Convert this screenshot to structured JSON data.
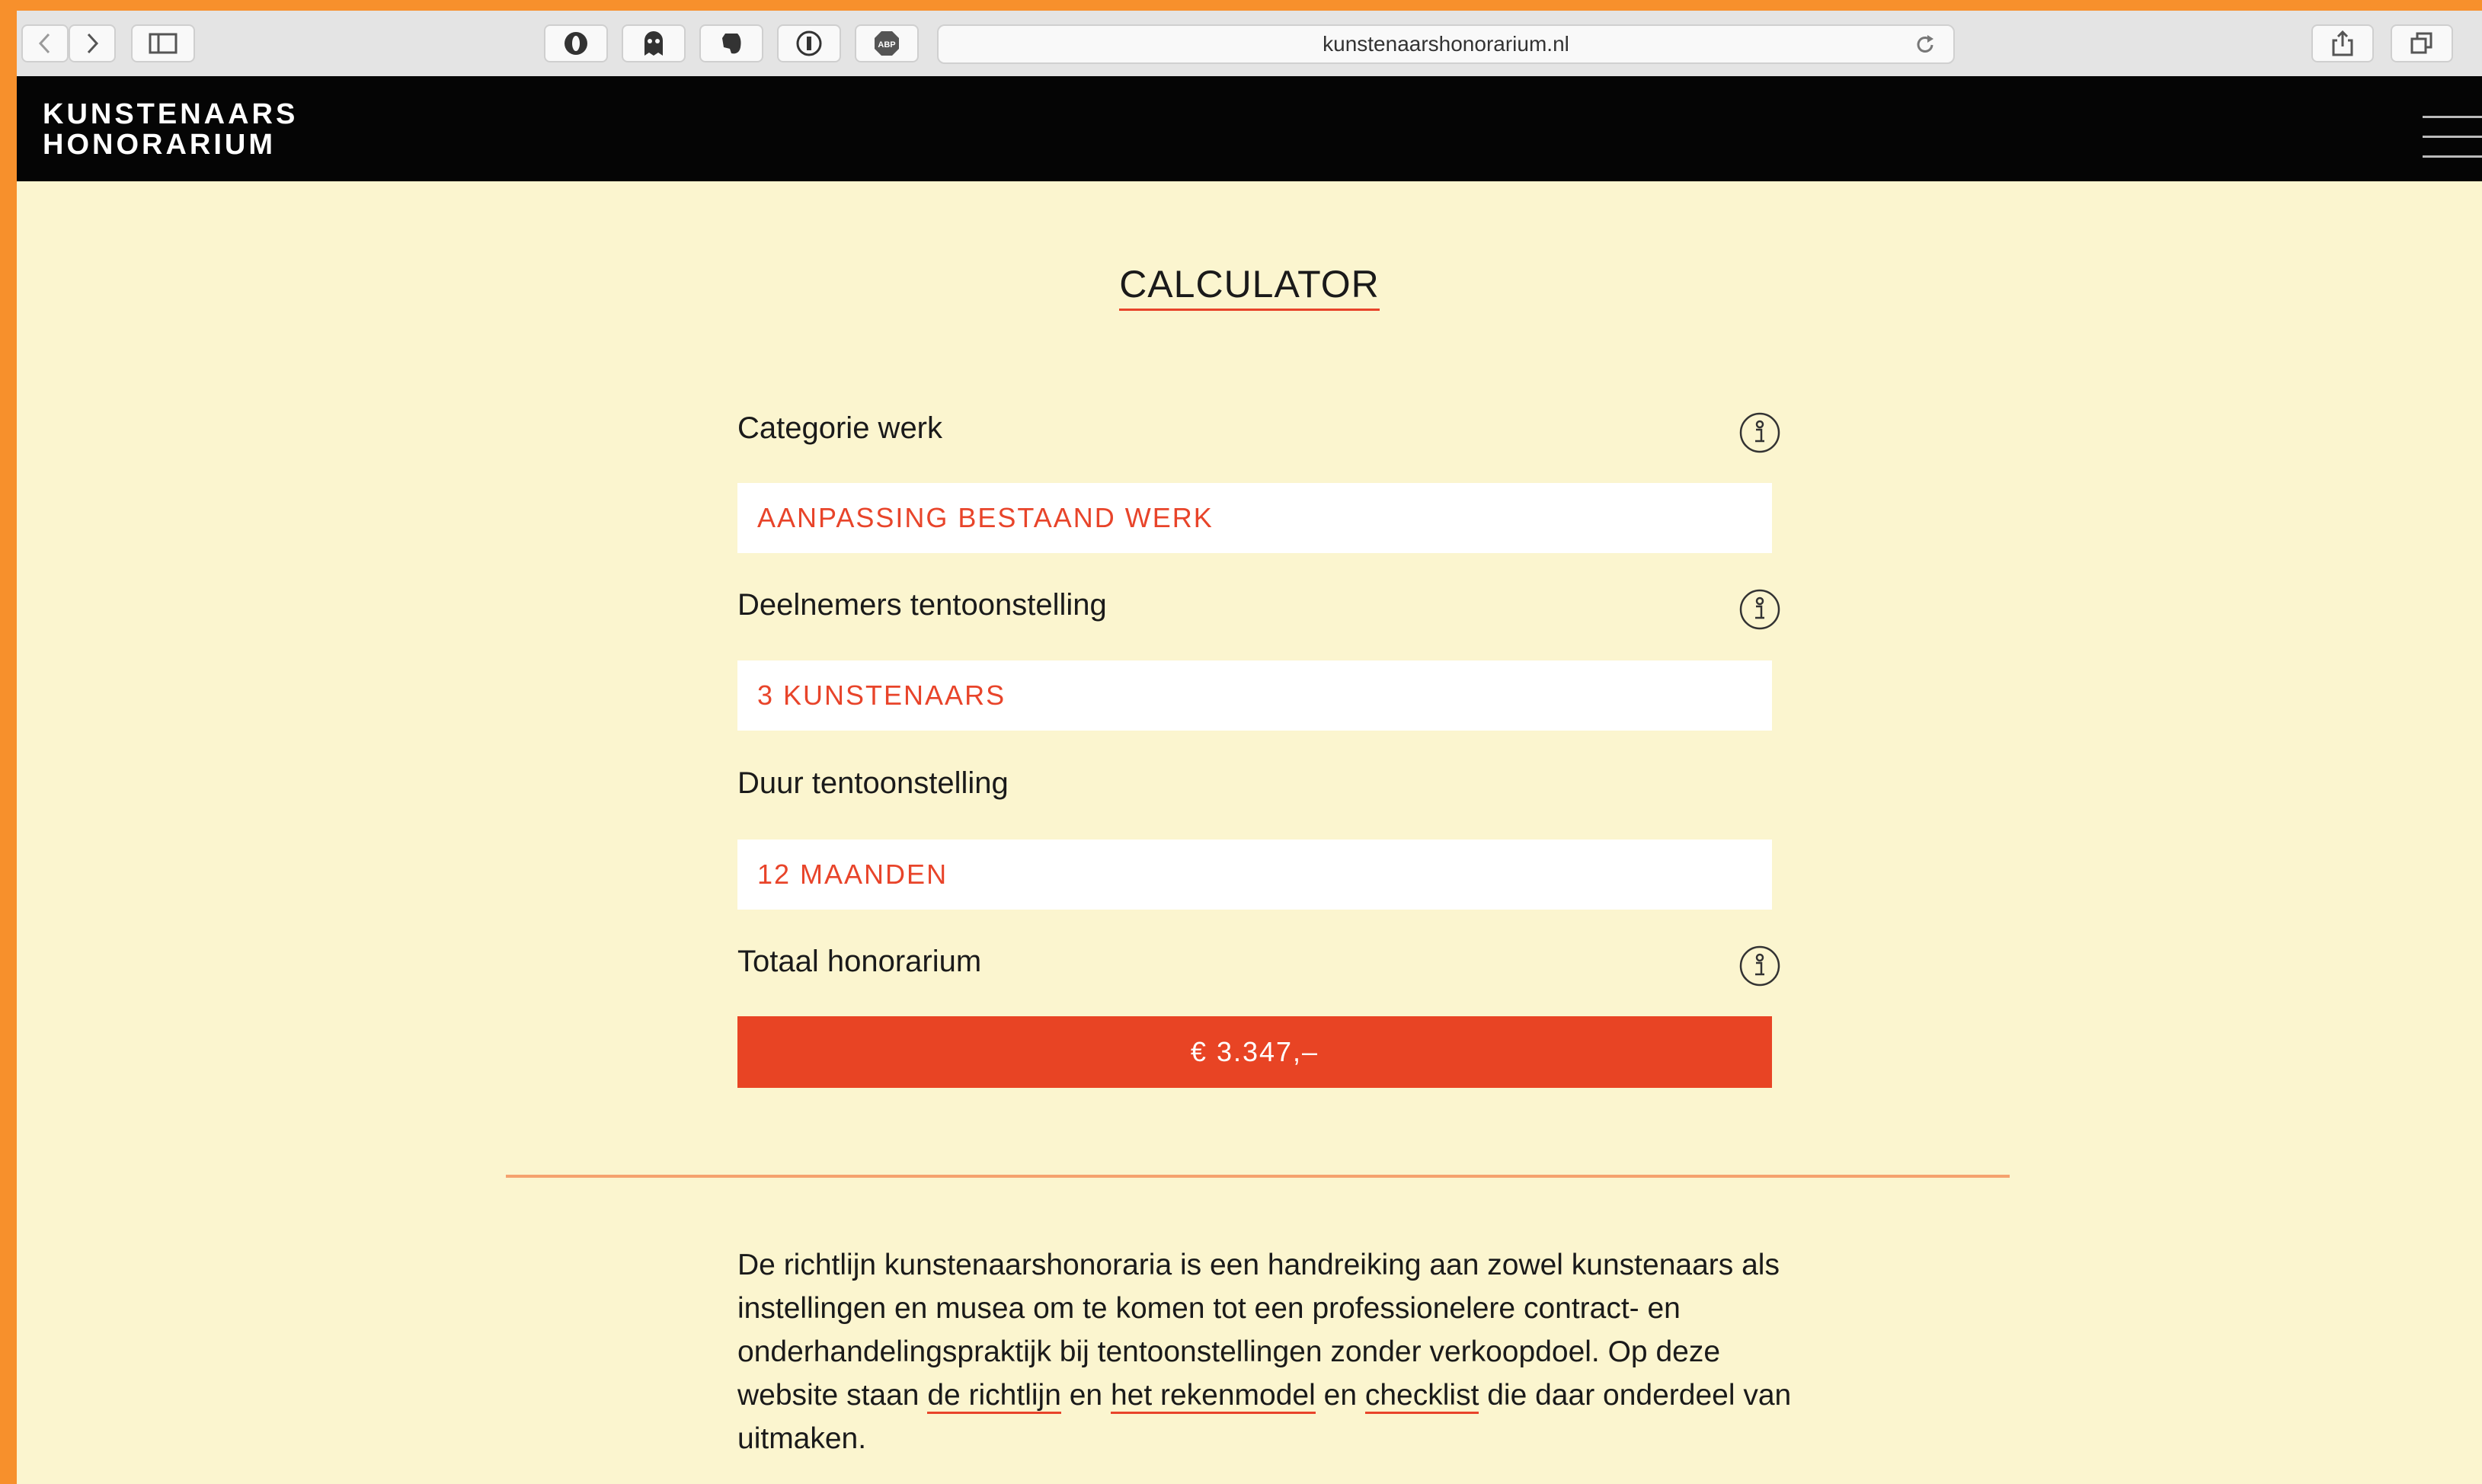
{
  "browser": {
    "url": "kunstenaarshonorarium.nl",
    "extensions": [
      "privacy-badger-icon",
      "ghostery-icon",
      "evernote-icon",
      "1password-icon",
      "adblock-plus-icon"
    ]
  },
  "header": {
    "logo_line1": "KUNSTENAARS",
    "logo_line2": "HONORARIUM"
  },
  "main": {
    "title": "CALCULATOR",
    "fields": [
      {
        "label": "Categorie werk",
        "value": "AANPASSING BESTAAND WERK"
      },
      {
        "label": "Deelnemers tentoonstelling",
        "value": "3 KUNSTENAARS"
      },
      {
        "label": "Duur tentoonstelling",
        "value": "12 MAANDEN"
      }
    ],
    "total": {
      "label": "Totaal honorarium",
      "value": "€ 3.347,–"
    }
  },
  "intro": {
    "part1": "De richtlijn kunstenaarshonoraria is een handreiking aan zowel kunstenaars als instellingen en musea om te komen tot een professionelere contract- en onderhandelingspraktijk bij tentoonstellingen zonder verkoopdoel. Op deze website staan ",
    "link1": "de richtlijn",
    "sep1": " en ",
    "link2": "het rekenmodel",
    "sep2": " en ",
    "link3": "checklist",
    "part2": " die daar onderdeel van uitmaken."
  },
  "colors": {
    "accent": "#e8442a",
    "background": "#fbf5cf",
    "header": "#050505",
    "frame": "#f7902c"
  }
}
